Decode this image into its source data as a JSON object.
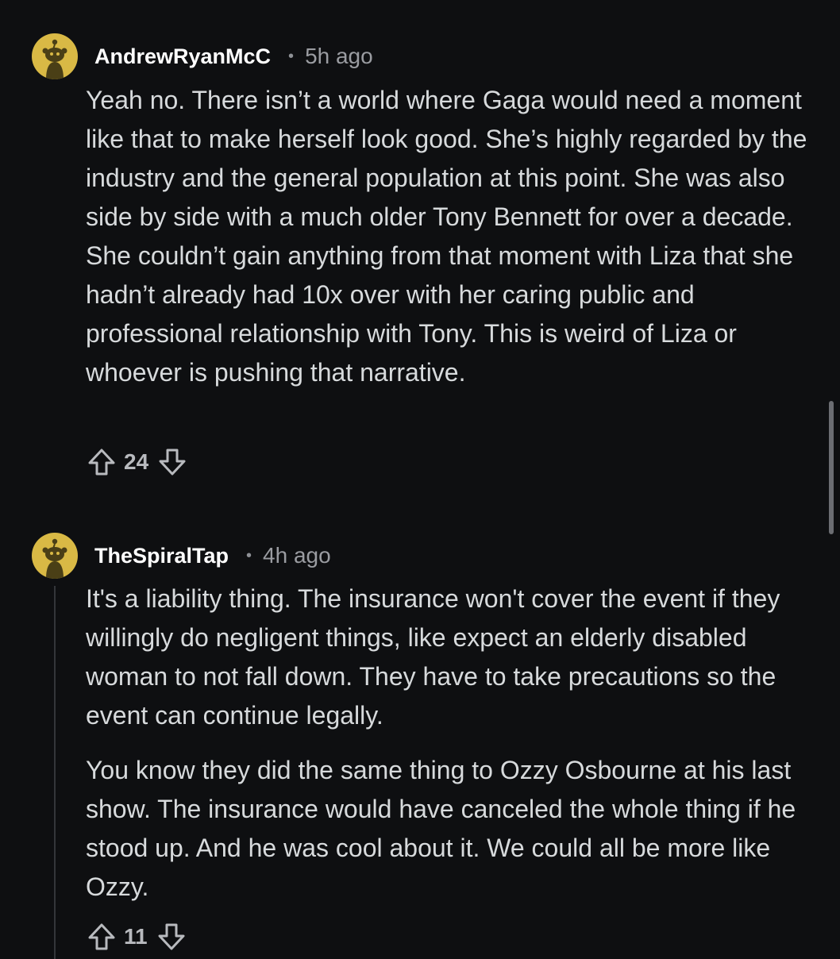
{
  "comments": [
    {
      "username": "AndrewRyanMcC",
      "separator": "•",
      "time": "5h ago",
      "paragraphs": [
        "Yeah no. There isn’t a world where Gaga would need a moment like that to make herself look good. She’s highly regarded by the industry and the general population at this point. She was also side by side with a much older Tony Bennett for over a decade. She couldn’t gain anything from that moment with Liza that she hadn’t already had 10x over with her caring public and professional relationship with Tony. This is weird of Liza or whoever is pushing that narrative."
      ],
      "score": "24",
      "avatar_icon": "snoo-avatar-icon",
      "avatar_color": "#d9b945"
    },
    {
      "username": "TheSpiralTap",
      "separator": "•",
      "time": "4h ago",
      "paragraphs": [
        "It's a liability thing. The insurance won't cover the event if they willingly do negligent things, like expect an elderly disabled woman to not fall down. They have to take precautions so the event can continue legally.",
        "You know they did the same thing to Ozzy Osbourne at his last show. The insurance would have canceled the whole thing if he stood up. And he was cool about it. We could all be more like Ozzy."
      ],
      "score": "11",
      "avatar_icon": "snoo-avatar-icon",
      "avatar_color": "#d9b945"
    }
  ],
  "icons": {
    "upvote": "upvote-arrow-icon",
    "downvote": "downvote-arrow-icon"
  },
  "colors": {
    "background": "#0e0f11",
    "text": "#d7dadc",
    "username": "#ffffff",
    "meta": "#9a9ca1",
    "avatar": "#d9b945"
  }
}
